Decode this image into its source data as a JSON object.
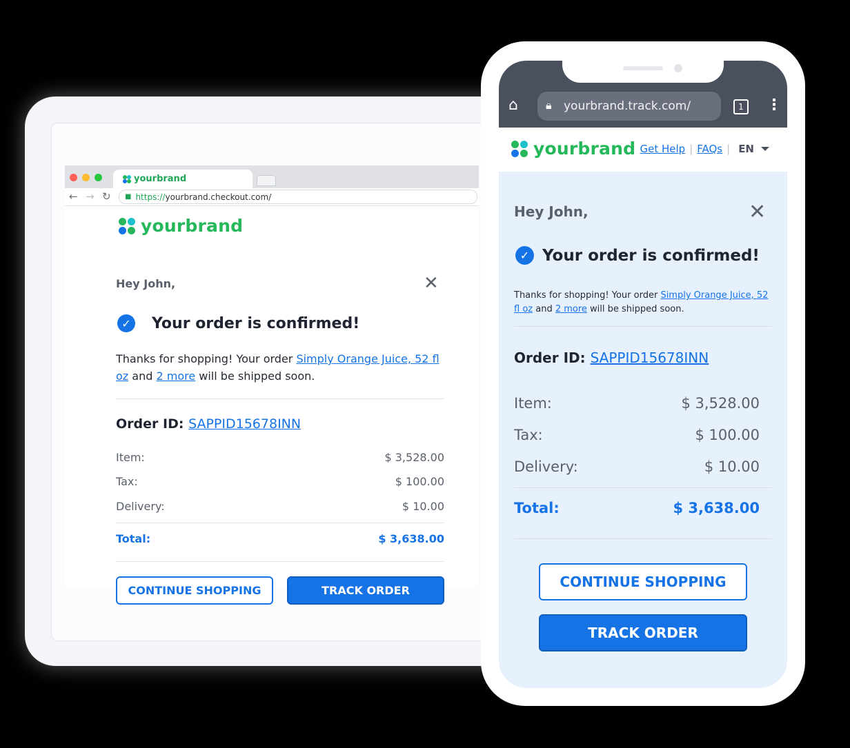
{
  "brand": {
    "name": "yourbrand",
    "logo_colors": [
      "#24b85a",
      "#1ec0c9",
      "#1673e6",
      "#24b85a"
    ]
  },
  "desktop": {
    "tab_title": "yourbrand",
    "url_scheme": "https://",
    "url_rest": "yourbrand.checkout.com/",
    "email": {
      "greeting": "Hey John,",
      "headline": "Your order is confirmed!",
      "intro_prefix": "Thanks for shopping! Your order ",
      "product_link": "Simply Orange Juice, 52 fl oz",
      "intro_and": " and ",
      "more_link": "2 more",
      "intro_suffix": " will be shipped soon.",
      "order_id_label": "Order ID:",
      "order_id": "SAPPID15678INN",
      "rows": [
        {
          "label": "Item:",
          "value": "$ 3,528.00"
        },
        {
          "label": "Tax:",
          "value": "$ 100.00"
        },
        {
          "label": "Delivery:",
          "value": "$ 10.00"
        }
      ],
      "total_label": "Total:",
      "total_value": "$ 3,638.00",
      "continue_label": "CONTINUE SHOPPING",
      "track_label": "TRACK ORDER"
    }
  },
  "mobile": {
    "url": "yourbrand.track.com/",
    "tab_count": "1",
    "links": {
      "help": "Get Help",
      "faqs": "FAQs",
      "lang": "EN"
    },
    "email": {
      "greeting": "Hey John,",
      "headline": "Your order is confirmed!",
      "intro_prefix": "Thanks for shopping! Your order ",
      "product_link": "Simply Orange Juice, 52 fl oz",
      "intro_and": " and ",
      "more_link": "2 more",
      "intro_suffix": " will be shipped soon.",
      "order_id_label": "Order ID:",
      "order_id": "SAPPID15678INN",
      "rows": [
        {
          "label": "Item:",
          "value": "$ 3,528.00"
        },
        {
          "label": "Tax:",
          "value": "$ 100.00"
        },
        {
          "label": "Delivery:",
          "value": "$ 10.00"
        }
      ],
      "total_label": "Total:",
      "total_value": "$ 3,638.00",
      "continue_label": "CONTINUE SHOPPING",
      "track_label": "TRACK ORDER"
    }
  },
  "colors": {
    "accent": "#1673e6",
    "brand_green": "#24b85a",
    "phone_bar": "#4b505e",
    "phone_bg": "#e6f1fd"
  }
}
